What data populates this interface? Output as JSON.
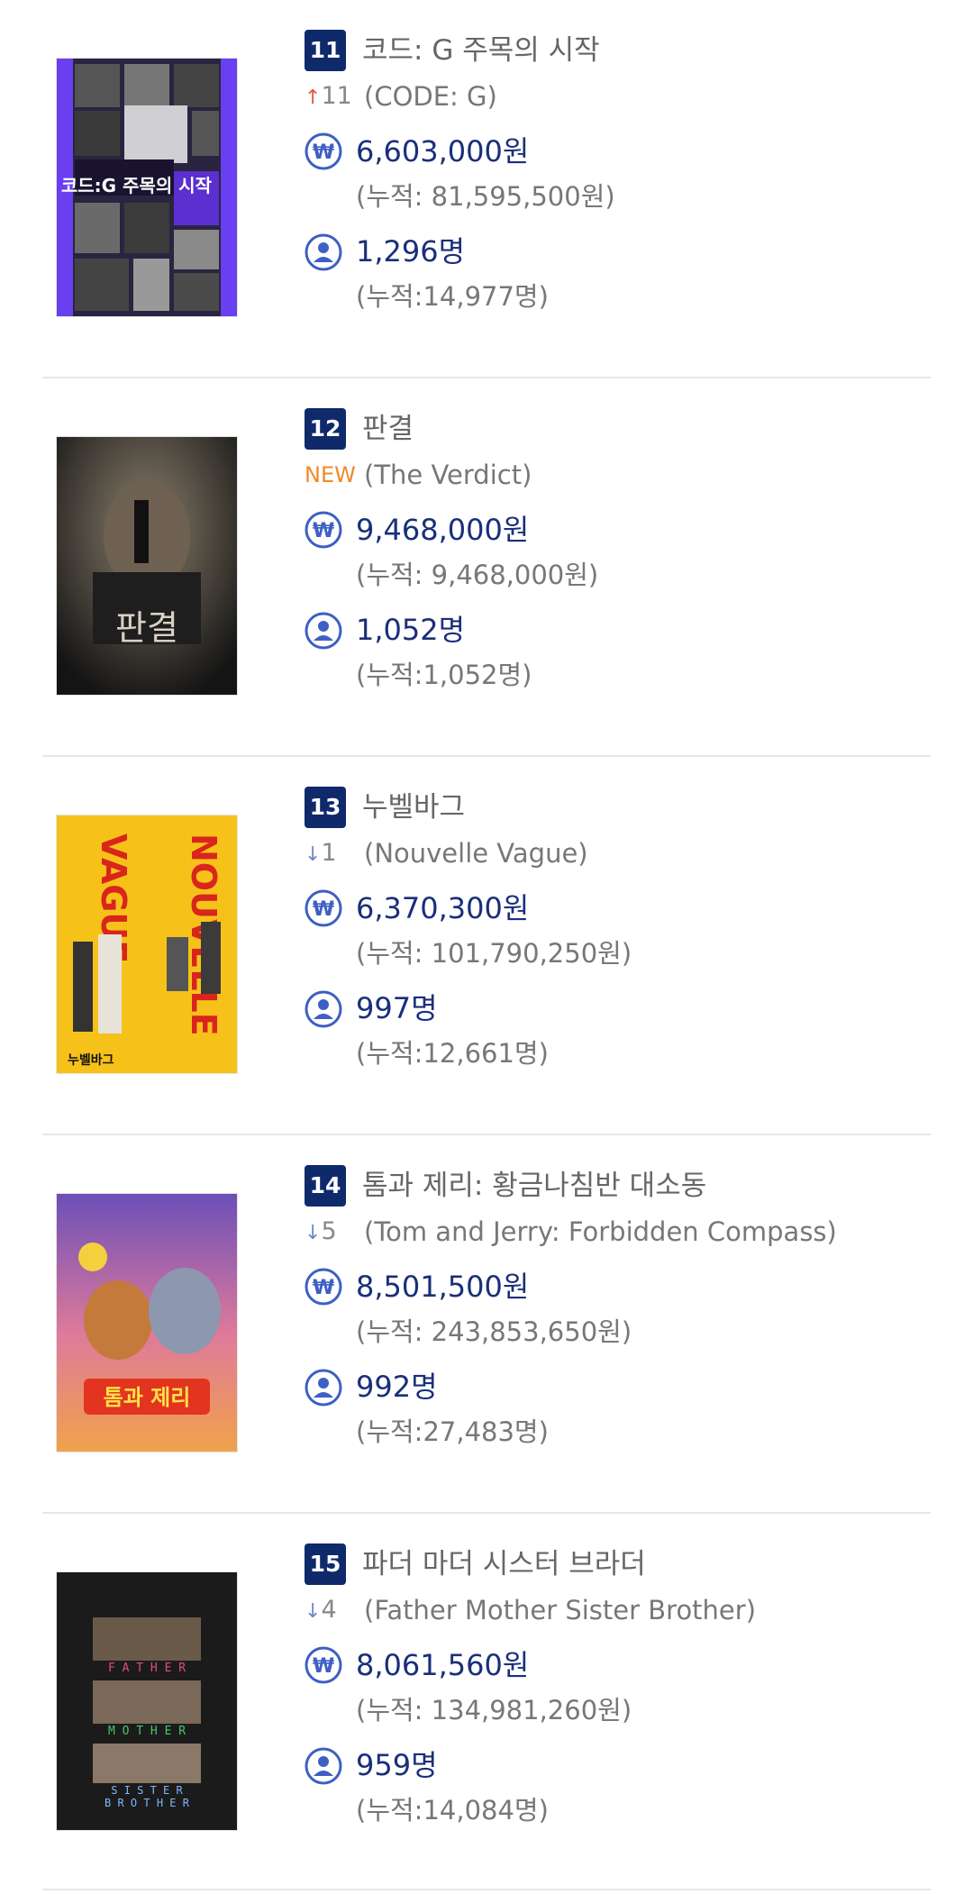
{
  "colors": {
    "rank_badge": "#0f2a6b",
    "stat_value": "#1a2f7a",
    "icon": "#3e5fc4",
    "up": "#e8553e",
    "down": "#6f88cc",
    "new": "#f08a2a"
  },
  "movies": [
    {
      "rank": "11",
      "title": "코드: G 주목의 시작",
      "change_type": "up",
      "change_icon": "↑",
      "change_value": "11",
      "original_title": "(CODE: G)",
      "revenue": "6,603,000원",
      "revenue_total": "(누적: 81,595,500원)",
      "audience": "1,296명",
      "audience_total": "(누적:14,977명)",
      "poster_text": "코드:G 주목의 시작",
      "poster_icon": "code-g-poster-image"
    },
    {
      "rank": "12",
      "title": "판결",
      "change_type": "new",
      "change_icon": "",
      "change_value": "NEW",
      "original_title": "(The Verdict)",
      "revenue": "9,468,000원",
      "revenue_total": "(누적: 9,468,000원)",
      "audience": "1,052명",
      "audience_total": "(누적:1,052명)",
      "poster_text": "판결",
      "poster_icon": "verdict-poster-image"
    },
    {
      "rank": "13",
      "title": "누벨바그",
      "change_type": "down",
      "change_icon": "↓",
      "change_value": "1",
      "original_title": "(Nouvelle Vague)",
      "revenue": "6,370,300원",
      "revenue_total": "(누적: 101,790,250원)",
      "audience": "997명",
      "audience_total": "(누적:12,661명)",
      "poster_text": "NOUVELLE VAGUE",
      "poster_icon": "nouvelle-vague-poster-image"
    },
    {
      "rank": "14",
      "title": "톰과 제리: 황금나침반 대소동",
      "change_type": "down",
      "change_icon": "↓",
      "change_value": "5",
      "original_title": "(Tom and Jerry: Forbidden Compass)",
      "revenue": "8,501,500원",
      "revenue_total": "(누적: 243,853,650원)",
      "audience": "992명",
      "audience_total": "(누적:27,483명)",
      "poster_text": "톰과 제리",
      "poster_icon": "tom-and-jerry-poster-image"
    },
    {
      "rank": "15",
      "title": "파더 마더 시스터 브라더",
      "change_type": "down",
      "change_icon": "↓",
      "change_value": "4",
      "original_title": "(Father Mother Sister Brother)",
      "revenue": "8,061,560원",
      "revenue_total": "(누적: 134,981,260원)",
      "audience": "959명",
      "audience_total": "(누적:14,084명)",
      "poster_text": "FATHER MOTHER SISTER BROTHER",
      "poster_icon": "father-mother-sister-brother-poster-image"
    }
  ]
}
